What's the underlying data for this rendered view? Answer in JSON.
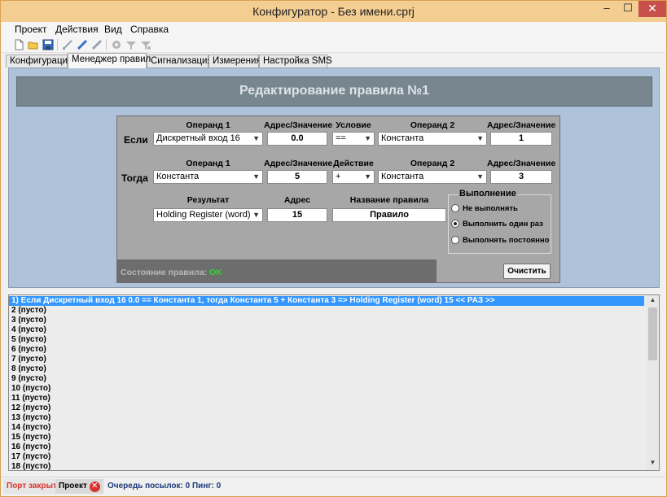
{
  "window": {
    "title": "Конфигуратор - Без имени.cprj",
    "controls": {
      "minimize": "–",
      "maximize": "☐",
      "close": "✕"
    }
  },
  "menu": [
    "Проект",
    "Действия",
    "Вид",
    "Справка"
  ],
  "tabs": [
    "Конфигурация",
    "Менеджер правил",
    "Сигнализация",
    "Измерения",
    "Настройка SMS"
  ],
  "active_tab": "Менеджер правил",
  "header": {
    "title": "Редактирование правила №1"
  },
  "rule_editor": {
    "if_row": {
      "label": "Если",
      "operand1_header": "Операнд 1",
      "operand1_value": "Дискретный вход 16",
      "address1_header": "Адрес/Значение",
      "address1_value": "0.0",
      "condition_header": "Условие",
      "condition_value": "==",
      "operand2_header": "Операнд 2",
      "operand2_value": "Константа",
      "address2_header": "Адрес/Значение",
      "address2_value": "1"
    },
    "then_row": {
      "label": "Тогда",
      "operand1_header": "Операнд 1",
      "operand1_value": "Константа",
      "address1_header": "Адрес/Значение",
      "address1_value": "5",
      "action_header": "Действие",
      "action_value": "+",
      "operand2_header": "Операнд 2",
      "operand2_value": "Константа",
      "address2_header": "Адрес/Значение",
      "address2_value": "3"
    },
    "result_row": {
      "result_header": "Результат",
      "result_value": "Holding Register (word)",
      "address_header": "Адрес",
      "address_value": "15",
      "rule_name_header": "Название правила",
      "rule_name_value": "Правило"
    },
    "execution": {
      "title": "Выполнение",
      "options": [
        "Не выполнять",
        "Выполнить один раз",
        "Выполнять постоянно"
      ],
      "selected": "Выполнить один раз"
    },
    "status": {
      "label": "Состояние правила:",
      "value": "OK"
    },
    "clear_button": "Очистить"
  },
  "rules_list": [
    "1) Если Дискретный вход 16 0.0 == Константа 1, тогда Константа 5 + Константа 3 => Holding Register (word) 15 << РАЗ >>",
    "2 (пусто)",
    "3 (пусто)",
    "4 (пусто)",
    "5 (пусто)",
    "6 (пусто)",
    "7 (пусто)",
    "8 (пусто)",
    "9 (пусто)",
    "10 (пусто)",
    "11 (пусто)",
    "12 (пусто)",
    "13 (пусто)",
    "14 (пусто)",
    "15 (пусто)",
    "16 (пусто)",
    "17 (пусто)",
    "18 (пусто)"
  ],
  "statusbar": {
    "port": "Порт закрыт",
    "project": "Проект",
    "queue": "Очередь посылок: 0 Пинг: 0"
  },
  "colors": {
    "header_bg": "#77868f",
    "content_bg": "#aec2d9",
    "panel_bg": "#a7a7a7",
    "selection": "#3397ff",
    "status_ok": "#31d331",
    "port_closed": "#d8342f"
  }
}
